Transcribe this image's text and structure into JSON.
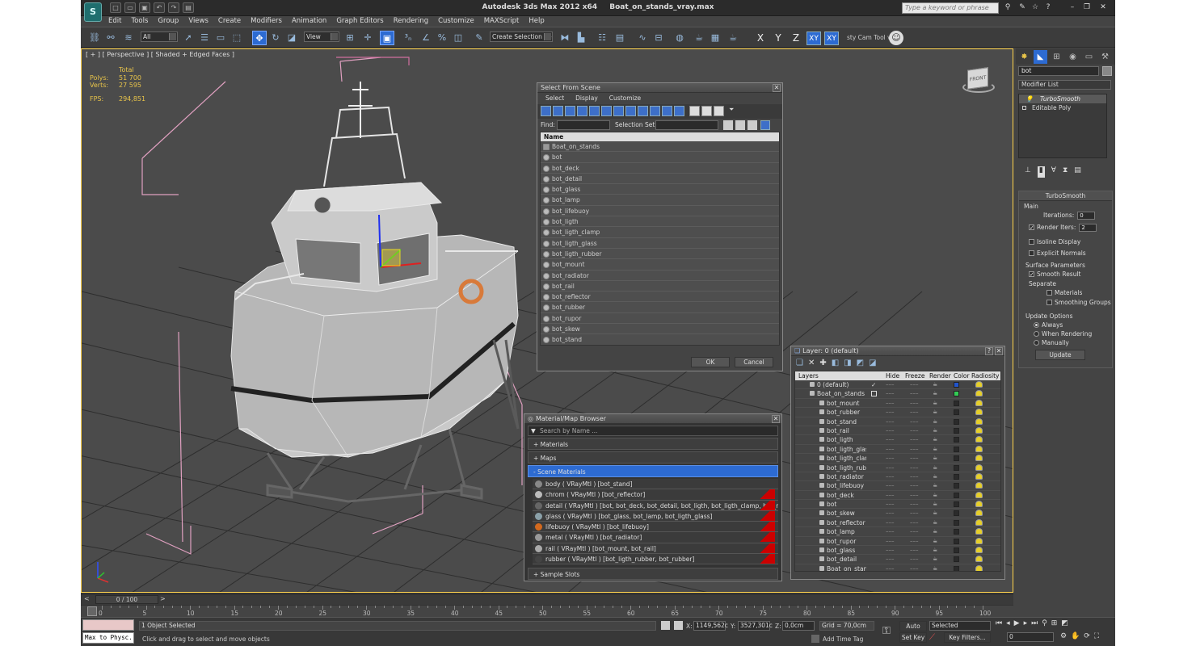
{
  "app": {
    "title_app": "Autodesk 3ds Max  2012 x64",
    "title_file": "Boat_on_stands_vray.max",
    "search_placeholder": "Type a keyword or phrase",
    "logo": "3ds-max-logo-icon"
  },
  "menu": [
    "Edit",
    "Tools",
    "Group",
    "Views",
    "Create",
    "Modifiers",
    "Animation",
    "Graph Editors",
    "Rendering",
    "Customize",
    "MAXScript",
    "Help"
  ],
  "toolbar": {
    "filter_dropdown": "All",
    "view_dropdown": "View",
    "selection_set": "Create Selection Se",
    "axes": [
      "X",
      "Y",
      "Z",
      "XY",
      "XY"
    ],
    "cam_tool": "sty Cam Tool v"
  },
  "viewport": {
    "label": "[ + ] [ Perspective ] [ Shaded + Edged Faces ]",
    "stats_header": "Total",
    "stats": [
      {
        "key": "Polys:",
        "value": "51 700"
      },
      {
        "key": "Verts:",
        "value": "27 595"
      }
    ],
    "fps_key": "FPS:",
    "fps_value": "294,851",
    "viewcube_label": "FRONT"
  },
  "select_dialog": {
    "title": "Select From Scene",
    "menus": [
      "Select",
      "Display",
      "Customize"
    ],
    "find_label": "Find:",
    "selset_label": "Selection Set:",
    "column": "Name",
    "items": [
      "Boat_on_stands",
      "bot",
      "bot_deck",
      "bot_detail",
      "bot_glass",
      "bot_lamp",
      "bot_lifebuoy",
      "bot_ligth",
      "bot_ligth_clamp",
      "bot_ligth_glass",
      "bot_ligth_rubber",
      "bot_mount",
      "bot_radiator",
      "bot_rail",
      "bot_reflector",
      "bot_rubber",
      "bot_rupor",
      "bot_skew",
      "bot_stand"
    ],
    "ok": "OK",
    "cancel": "Cancel"
  },
  "material_browser": {
    "title": "Material/Map Browser",
    "search_placeholder": "Search by Name ...",
    "sections": [
      "+ Materials",
      "+ Maps",
      "- Scene Materials"
    ],
    "materials": [
      {
        "name": "body  ( VRayMtl ) [bot_stand]",
        "color": "#888888",
        "red": false
      },
      {
        "name": "chrom  ( VRayMtl ) [bot_reflector]",
        "color": "#bbbbbb",
        "red": true
      },
      {
        "name": "detail  ( VRayMtl ) [bot, bot_deck, bot_detail, bot_ligth, bot_ligth_clamp, bot_ru...",
        "color": "#666666",
        "red": true
      },
      {
        "name": "glass  ( VRayMtl ) [bot_glass, bot_lamp, bot_ligth_glass]",
        "color": "#8aa0a8",
        "red": true
      },
      {
        "name": "lifebuoy  ( VRayMtl ) [bot_lifebuoy]",
        "color": "#d2691e",
        "red": true
      },
      {
        "name": "metal  ( VRayMtl ) [bot_radiator]",
        "color": "#999999",
        "red": true
      },
      {
        "name": "rail  ( VRayMtl ) [bot_mount, bot_rail]",
        "color": "#aaaaaa",
        "red": true
      },
      {
        "name": "rubber  ( VRayMtl ) [bot_ligth_rubber, bot_rubber]",
        "color": "#444444",
        "red": true
      }
    ],
    "footer": "+ Sample Slots"
  },
  "layer_dialog": {
    "title": "Layer: 0 (default)",
    "columns": [
      "Layers",
      "Hide",
      "Freeze",
      "Render",
      "Color",
      "Radiosity"
    ],
    "layers": [
      {
        "name": "0 (default)",
        "level": 0,
        "color": "#2255cc"
      },
      {
        "name": "Boat_on_stands",
        "level": 0,
        "color": "#33cc55"
      },
      {
        "name": "bot_mount",
        "level": 1,
        "color": "#2b2b2b"
      },
      {
        "name": "bot_rubber",
        "level": 1,
        "color": "#2b2b2b"
      },
      {
        "name": "bot_stand",
        "level": 1,
        "color": "#2b2b2b"
      },
      {
        "name": "bot_rail",
        "level": 1,
        "color": "#2b2b2b"
      },
      {
        "name": "bot_ligth",
        "level": 1,
        "color": "#2b2b2b"
      },
      {
        "name": "bot_ligth_glass",
        "level": 1,
        "color": "#2b2b2b"
      },
      {
        "name": "bot_ligth_clamp",
        "level": 1,
        "color": "#2b2b2b"
      },
      {
        "name": "bot_ligth_rubber",
        "level": 1,
        "color": "#2b2b2b"
      },
      {
        "name": "bot_radiator",
        "level": 1,
        "color": "#2b2b2b"
      },
      {
        "name": "bot_lifebuoy",
        "level": 1,
        "color": "#2b2b2b"
      },
      {
        "name": "bot_deck",
        "level": 1,
        "color": "#2b2b2b"
      },
      {
        "name": "bot",
        "level": 1,
        "color": "#2b2b2b"
      },
      {
        "name": "bot_skew",
        "level": 1,
        "color": "#2b2b2b"
      },
      {
        "name": "bot_reflector",
        "level": 1,
        "color": "#2b2b2b"
      },
      {
        "name": "bot_lamp",
        "level": 1,
        "color": "#2b2b2b"
      },
      {
        "name": "bot_rupor",
        "level": 1,
        "color": "#2b2b2b"
      },
      {
        "name": "bot_glass",
        "level": 1,
        "color": "#2b2b2b"
      },
      {
        "name": "bot_detail",
        "level": 1,
        "color": "#2b2b2b"
      },
      {
        "name": "Boat_on_stands",
        "level": 1,
        "color": "#2b2b2b"
      }
    ]
  },
  "command_panel": {
    "object_name": "bot",
    "modifier_list": "Modifier List",
    "stack": [
      "TurboSmooth",
      "Editable Poly"
    ],
    "turbosmooth_title": "TurboSmooth",
    "main_label": "Main",
    "iterations_label": "Iterations:",
    "iterations_value": "0",
    "render_iters_label": "Render Iters:",
    "render_iters_value": "2",
    "isoline": "Isoline Display",
    "explicit": "Explicit Normals",
    "surface_params": "Surface Parameters",
    "smooth_result": "Smooth Result",
    "separate": "Separate",
    "materials": "Materials",
    "smoothing_groups": "Smoothing Groups",
    "update_options": "Update Options",
    "always": "Always",
    "when_rendering": "When Rendering",
    "manually": "Manually",
    "update_button": "Update"
  },
  "timeline": {
    "frame": "0 / 100",
    "ticks": [
      "0",
      "5",
      "10",
      "15",
      "20",
      "25",
      "30",
      "35",
      "40",
      "45",
      "50",
      "55",
      "60",
      "65",
      "70",
      "75",
      "80",
      "85",
      "90",
      "95",
      "100"
    ]
  },
  "status": {
    "maxscript": "Max to Physc.",
    "selected": "1 Object Selected",
    "prompt": "Click and drag to select and move objects",
    "x_label": "X:",
    "x_value": "1149,562c",
    "y_label": "Y:",
    "y_value": "3527,301c",
    "z_label": "Z:",
    "z_value": "0,0cm",
    "grid": "Grid = 70,0cm",
    "add_time_tag": "Add Time Tag",
    "auto_key": "Auto Key",
    "set_key": "Set Key",
    "selected_dd": "Selected",
    "key_filters": "Key Filters...",
    "frame_field": "0"
  }
}
